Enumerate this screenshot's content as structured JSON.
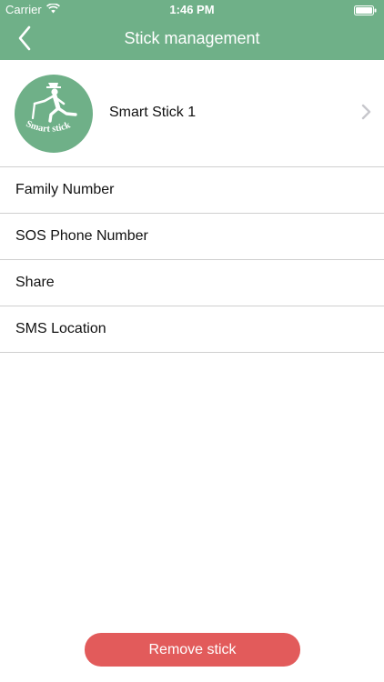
{
  "status_bar": {
    "carrier": "Carrier",
    "time": "1:46 PM",
    "wifi_icon": "wifi-icon",
    "battery_icon": "battery-full-icon"
  },
  "nav": {
    "title": "Stick management",
    "back_icon": "chevron-left-icon"
  },
  "device": {
    "name": "Smart Stick 1",
    "avatar_text": "Smart stick",
    "avatar_icon": "walking-person-with-cane-icon",
    "chevron_icon": "chevron-right-icon"
  },
  "menu": {
    "items": [
      {
        "label": "Family Number"
      },
      {
        "label": "SOS Phone Number"
      },
      {
        "label": "Share"
      },
      {
        "label": "SMS Location"
      }
    ]
  },
  "actions": {
    "remove_label": "Remove stick"
  },
  "colors": {
    "header_green": "#6fb088",
    "danger_red": "#e25b5b",
    "divider": "#cfcfcf"
  }
}
